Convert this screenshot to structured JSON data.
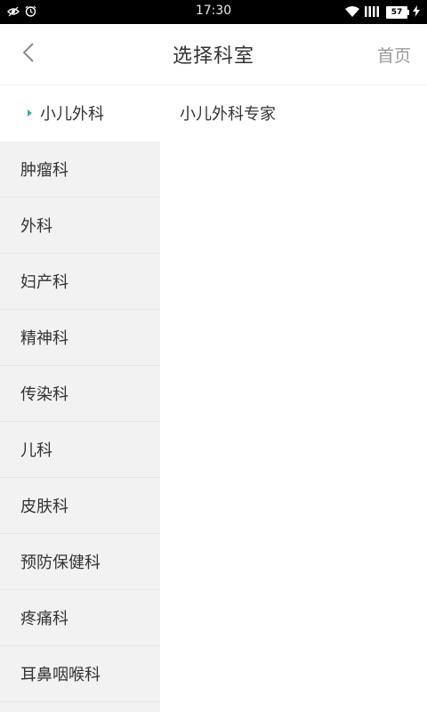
{
  "status_bar": {
    "time": "17:30",
    "battery": "57",
    "left_icons": [
      "eye-icon",
      "alarm-icon"
    ],
    "right_icons": [
      "wifi-icon",
      "signal-icon",
      "battery-icon",
      "charging-icon"
    ]
  },
  "header": {
    "title": "选择科室",
    "home": "首页",
    "back_icon": "chevron-left-icon"
  },
  "sidebar": {
    "items": [
      {
        "label": "小儿外科",
        "active": true
      },
      {
        "label": "肿瘤科"
      },
      {
        "label": "外科"
      },
      {
        "label": "妇产科"
      },
      {
        "label": "精神科"
      },
      {
        "label": "传染科"
      },
      {
        "label": "儿科"
      },
      {
        "label": "皮肤科"
      },
      {
        "label": "预防保健科"
      },
      {
        "label": "疼痛科"
      },
      {
        "label": "耳鼻咽喉科"
      }
    ]
  },
  "content": {
    "items": [
      {
        "label": "小儿外科专家"
      }
    ]
  },
  "colors": {
    "accent": "#2bb5a2",
    "sidebar_bg": "#f2f2f2",
    "text": "#333333",
    "muted": "#9a9a9a"
  }
}
